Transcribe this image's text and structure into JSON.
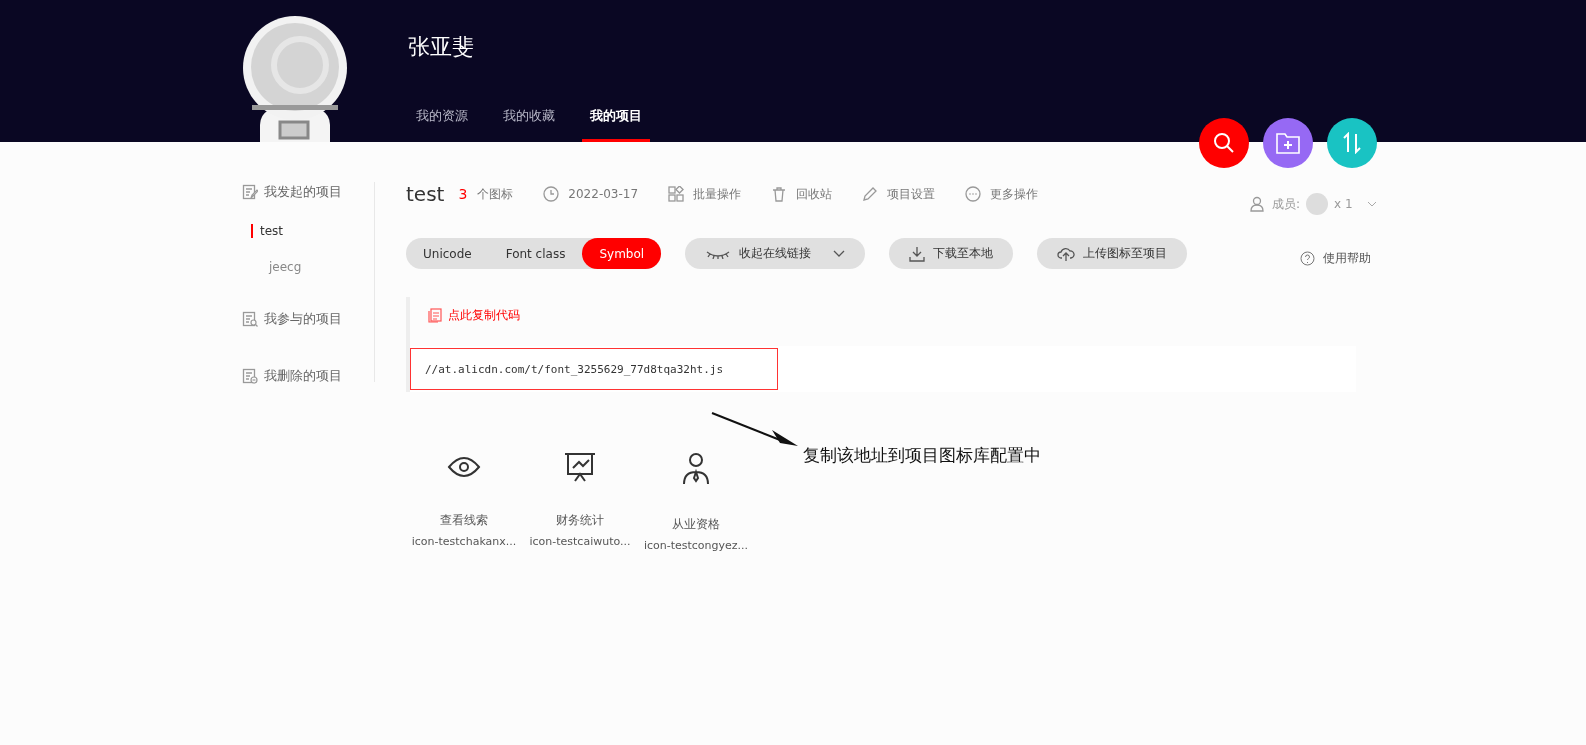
{
  "header": {
    "user_name": "张亚斐",
    "tabs": [
      {
        "label": "我的资源",
        "selected": false
      },
      {
        "label": "我的收藏",
        "selected": false
      },
      {
        "label": "我的项目",
        "selected": true
      }
    ]
  },
  "fab_buttons": [
    {
      "kind": "search",
      "color": "#ff0000"
    },
    {
      "kind": "add-folder",
      "color": "#9669f4"
    },
    {
      "kind": "sort",
      "color": "#19c3c3"
    }
  ],
  "sidebar": {
    "sections": [
      {
        "kind": "started",
        "label": "我发起的项目",
        "children": [
          {
            "label": "test",
            "selected": true
          },
          {
            "label": "jeecg",
            "selected": false
          }
        ]
      },
      {
        "kind": "joined",
        "label": "我参与的项目"
      },
      {
        "kind": "deleted",
        "label": "我删除的项目"
      }
    ]
  },
  "project": {
    "title": "test",
    "icon_count": "3",
    "icon_count_label": "个图标",
    "actions": [
      {
        "kind": "date",
        "label": "2022-03-17"
      },
      {
        "kind": "batch",
        "label": "批量操作"
      },
      {
        "kind": "trash",
        "label": "回收站"
      },
      {
        "kind": "settings",
        "label": "项目设置"
      },
      {
        "kind": "more",
        "label": "更多操作"
      }
    ],
    "members_label": "成员:",
    "members_count": "x 1"
  },
  "toolbar": {
    "formats": [
      {
        "label": "Unicode",
        "selected": false
      },
      {
        "label": "Font class",
        "selected": false
      },
      {
        "label": "Symbol",
        "selected": true
      }
    ],
    "buttons": [
      {
        "kind": "collapse",
        "label": "收起在线链接"
      },
      {
        "kind": "download",
        "label": "下载至本地"
      },
      {
        "kind": "upload",
        "label": "上传图标至项目"
      }
    ],
    "help": "使用帮助"
  },
  "code_panel": {
    "copy_label": "点此复制代码",
    "url": "//at.alicdn.com/t/font_3255629_77d8tqa32ht.js"
  },
  "annotation": "复制该地址到项目图标库配置中",
  "icons": [
    {
      "kind": "eye",
      "name": "查看线索",
      "code": "icon-testchakanx..."
    },
    {
      "kind": "chart",
      "name": "财务统计",
      "code": "icon-testcaiwuto..."
    },
    {
      "kind": "person",
      "name": "从业资格",
      "code": "icon-testcongyez..."
    }
  ]
}
